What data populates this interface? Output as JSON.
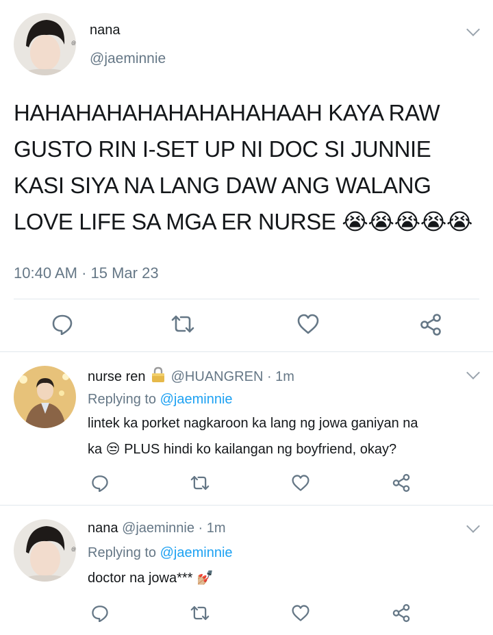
{
  "main_tweet": {
    "name": "nana",
    "handle": "@jaeminnie",
    "text": "HAHAHAHAHAHAHAHAHAAH KAYA RAW GUSTO RIN I-SET UP NI DOC SI JUNNIE KASI SIYA NA LANG DAW ANG WALANG LOVE LIFE SA MGA ER NURSE 😭😭😭😭😭",
    "timestamp": "10:40 AM · 15 Mar 23",
    "actions": [
      "reply-icon",
      "retweet-icon",
      "like-icon",
      "share-icon"
    ]
  },
  "replies": [
    {
      "name": "nurse ren",
      "handle": "@HUANGREN",
      "time": "· 1m",
      "locked": true,
      "replying_label": "Replying to",
      "replying_to": "@jaeminnie",
      "line1": "lintek ka porket nagkaroon ka lang ng jowa ganiyan na",
      "line2": "ka 😒 PLUS hindi ko kailangan ng boyfriend, okay?"
    },
    {
      "name": "nana",
      "handle": "@jaeminnie",
      "time": "· 1m",
      "locked": false,
      "replying_label": "Replying to",
      "replying_to": "@jaeminnie",
      "line1": "doctor na jowa*** 💅🏼",
      "line2": ""
    }
  ],
  "colors": {
    "text": "#14171a",
    "secondary": "#657786",
    "link": "#1da1f2",
    "divider": "#e1e8ed"
  }
}
